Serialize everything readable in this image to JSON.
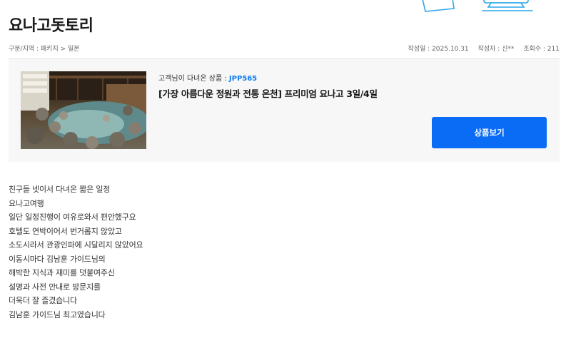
{
  "review": {
    "title": "요나고돗토리",
    "category": "구분/지역 : 패키지 > 일본",
    "date": "작성일 : 2025.10.31",
    "author": "작성자 : 신**",
    "views": "조회수 : 211"
  },
  "product": {
    "prefix": "고객님이 다녀온 상품 : ",
    "code": "JPP565",
    "name": "[가장 아름다운 정원과 전통 온천] 프리미엄 요나고 3일/4일",
    "button_label": "상품보기",
    "button_color": "#0a6cf5",
    "code_color": "#0a7cf5"
  },
  "content": {
    "lines": [
      "친구들 넷이서 다녀온 짧은 일정",
      "요나고여행",
      "일단 일정진행이 여유로와서 편안했구요",
      "호텔도 연박이어서 번거롭지 않았고",
      "소도시라서 관광인파에 시달리지 않았어요",
      "이동시마다 김남훈 가이드님의",
      "해박한 지식과 재미를 덧붙여주신",
      "설명과 사전 안내로 방문지를",
      "더욱더 잘 즐겼습니다",
      "김남훈 가이드님 최고였습니다"
    ]
  },
  "decor": {
    "illustration": "laptop-illustration"
  }
}
